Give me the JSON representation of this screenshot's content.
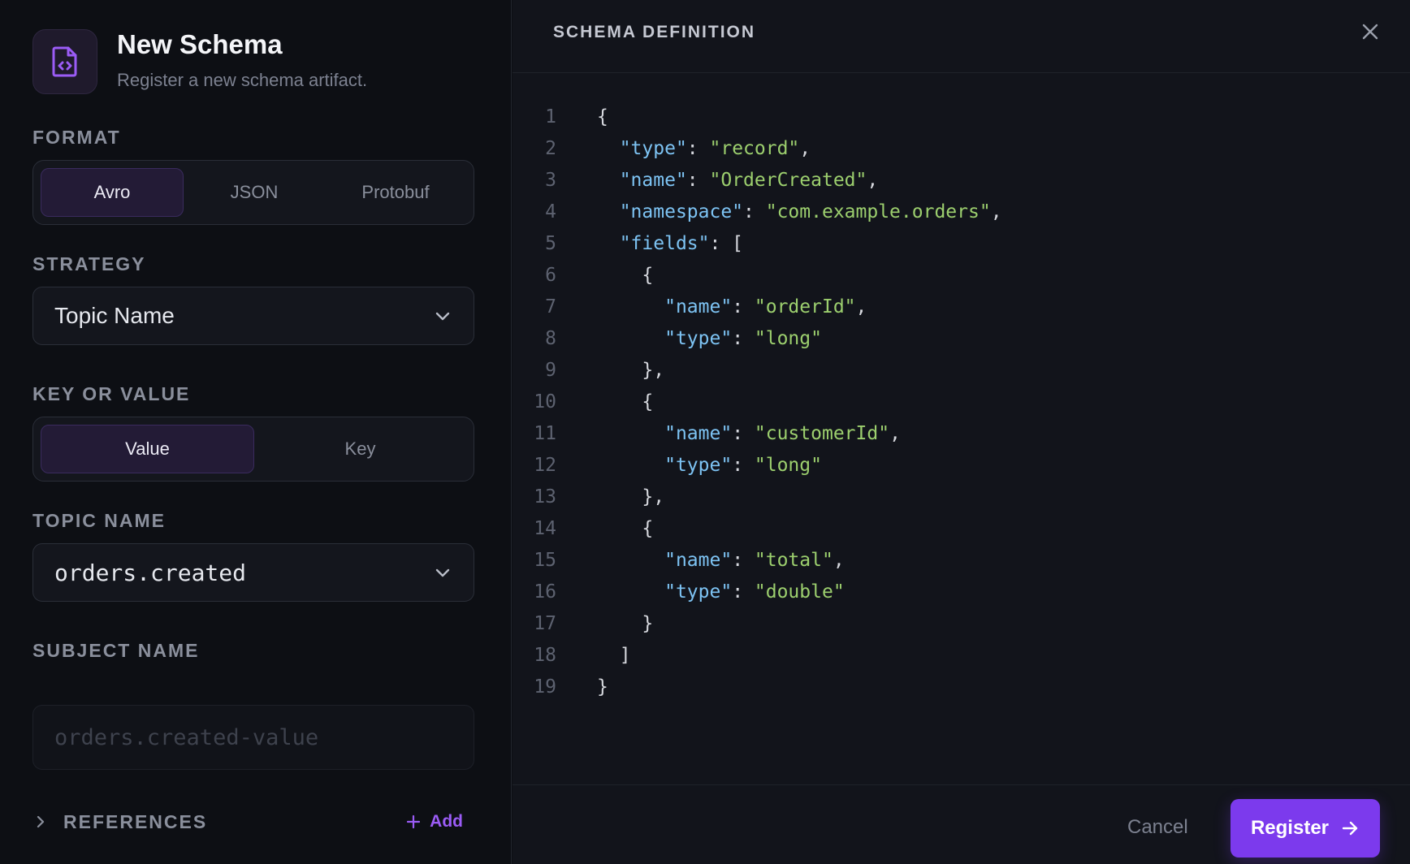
{
  "header": {
    "title": "New Schema",
    "subtitle": "Register a new schema artifact.",
    "icon": "file-code-icon"
  },
  "format": {
    "label": "FORMAT",
    "options": [
      "Avro",
      "JSON",
      "Protobuf"
    ],
    "selected": "Avro"
  },
  "strategy": {
    "label": "STRATEGY",
    "value": "Topic Name"
  },
  "key_or_value": {
    "label": "KEY OR VALUE",
    "options": [
      "Value",
      "Key"
    ],
    "selected": "Value"
  },
  "topic_name": {
    "label": "TOPIC NAME",
    "value": "orders.created"
  },
  "subject_name": {
    "label": "SUBJECT NAME",
    "value": "",
    "placeholder": "orders.created-value"
  },
  "references": {
    "label": "REFERENCES",
    "add_label": "Add"
  },
  "editor": {
    "title": "SCHEMA DEFINITION",
    "lines": [
      "{",
      "  \"type\": \"record\",",
      "  \"name\": \"OrderCreated\",",
      "  \"namespace\": \"com.example.orders\",",
      "  \"fields\": [",
      "    {",
      "      \"name\": \"orderId\",",
      "      \"type\": \"long\"",
      "    },",
      "    {",
      "      \"name\": \"customerId\",",
      "      \"type\": \"long\"",
      "    },",
      "    {",
      "      \"name\": \"total\",",
      "      \"type\": \"double\"",
      "    }",
      "  ]",
      "}"
    ]
  },
  "footer": {
    "cancel_label": "Cancel",
    "register_label": "Register"
  },
  "colors": {
    "accent": "#7c3aed",
    "json_key": "#7dc3f3",
    "json_string": "#9ccf6e"
  }
}
